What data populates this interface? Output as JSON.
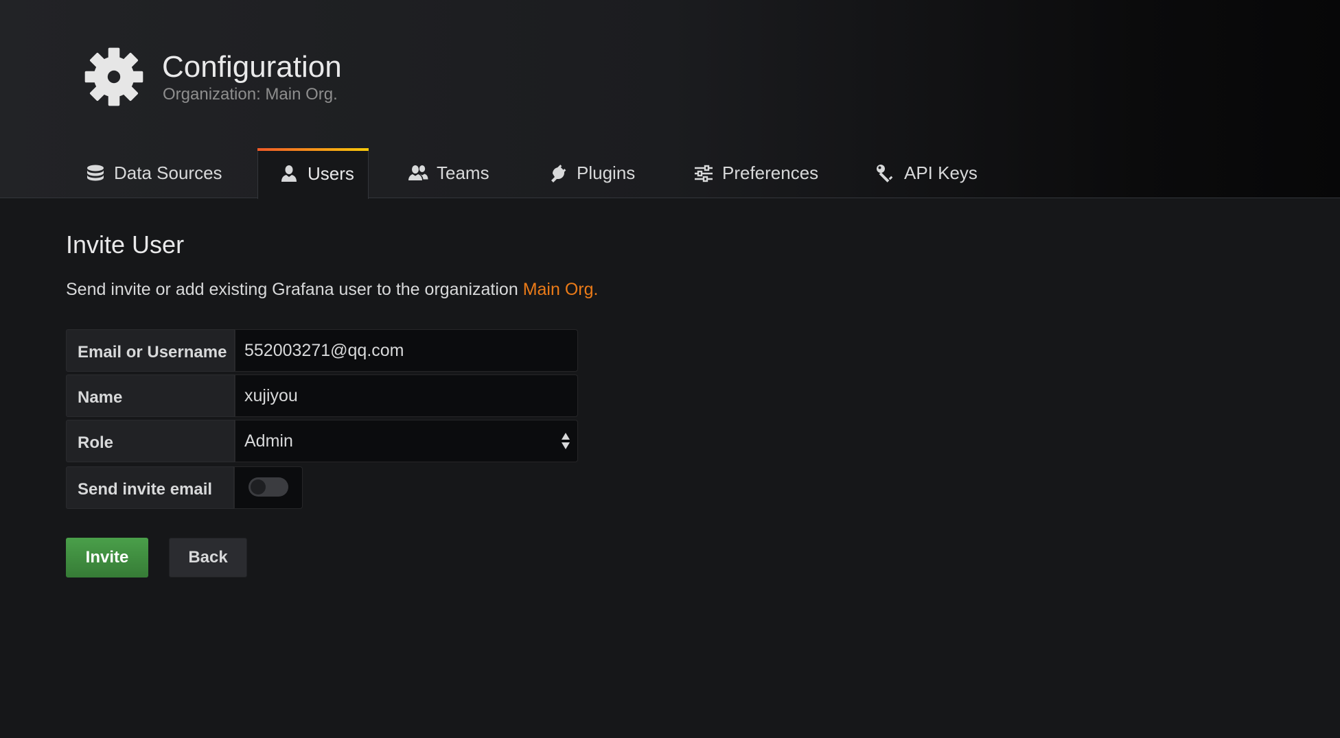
{
  "header": {
    "icon": "gear-icon",
    "title": "Configuration",
    "subtitle": "Organization: Main Org."
  },
  "tabs": [
    {
      "label": "Data Sources",
      "icon": "database-icon",
      "active": false
    },
    {
      "label": "Users",
      "icon": "user-icon",
      "active": true
    },
    {
      "label": "Teams",
      "icon": "users-icon",
      "active": false
    },
    {
      "label": "Plugins",
      "icon": "plug-icon",
      "active": false
    },
    {
      "label": "Preferences",
      "icon": "sliders-icon",
      "active": false
    },
    {
      "label": "API Keys",
      "icon": "key-icon",
      "active": false
    }
  ],
  "page": {
    "title": "Invite User",
    "description": "Send invite or add existing Grafana user to the organization ",
    "org_name": "Main Org."
  },
  "form": {
    "email": {
      "label": "Email or Username",
      "value": "552003271@qq.com"
    },
    "name": {
      "label": "Name",
      "value": "xujiyou"
    },
    "role": {
      "label": "Role",
      "value": "Admin"
    },
    "send_invite": {
      "label": "Send invite email",
      "checked": false
    }
  },
  "buttons": {
    "invite": "Invite",
    "back": "Back"
  },
  "colors": {
    "accent_orange": "#eb7b18",
    "invite_green": "#3f8f3f",
    "tab_gradient_start": "#f05a28",
    "tab_gradient_end": "#fbca0a"
  }
}
